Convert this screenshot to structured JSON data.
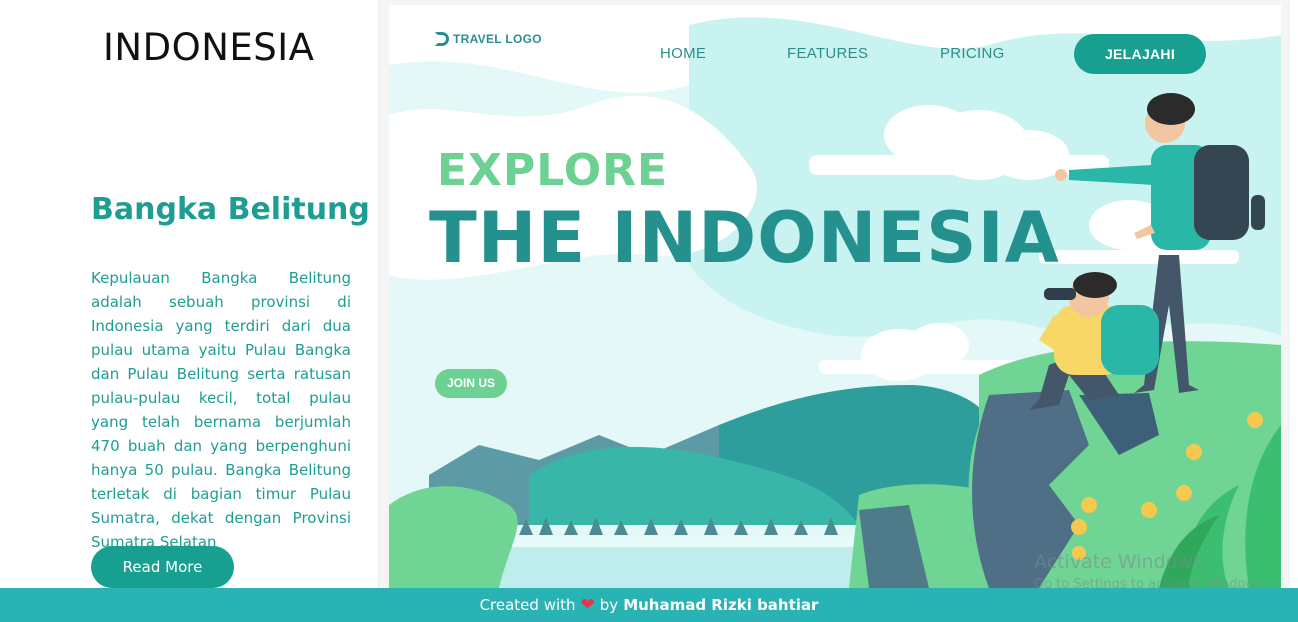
{
  "sidebar": {
    "brand": "INDONESIA",
    "region_title": "Bangka Belitung",
    "description": "Kepulauan Bangka Belitung adalah sebuah provinsi di Indonesia yang terdiri dari dua pulau utama yaitu Pulau Bangka dan Pulau Belitung serta ratusan pulau-pulau kecil, total pulau yang telah bernama berjumlah 470 buah dan yang berpenghuni hanya 50 pulau. Bangka Belitung terletak di bagian timur Pulau Sumatra, dekat dengan Provinsi Sumatra Selatan",
    "read_more_label": "Read More"
  },
  "hero": {
    "logo_text": "TRAVEL LOGO",
    "nav": {
      "home": "HOME",
      "features": "FEATURES",
      "pricing": "PRICING"
    },
    "cta_label": "JELAJAHI",
    "explore": "EXPLORE",
    "headline": "THE INDONESIA",
    "join_label": "JOIN US"
  },
  "watermark": {
    "line1": "Activate Windows",
    "line2": "Go to Settings to activate Windows."
  },
  "footer": {
    "prefix": "Created with",
    "heart_icon": "heart-icon",
    "by": "by",
    "author": "Muhamad Rizki bahtiar"
  },
  "colors": {
    "teal": "#17a090",
    "teal_text": "#1e9e92",
    "green_light": "#6dd193",
    "footer_bg": "#2ab3b4",
    "heart": "#e8334a"
  }
}
